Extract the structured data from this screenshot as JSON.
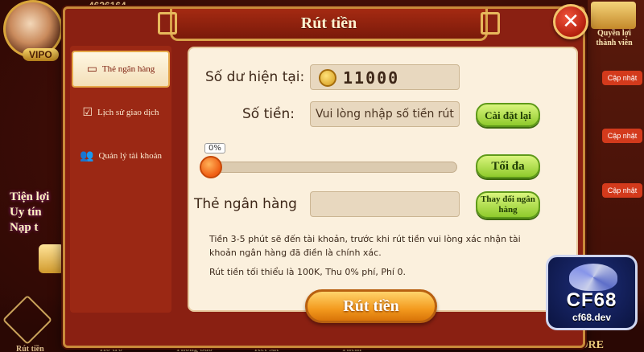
{
  "background": {
    "top_counter": "4626164",
    "vip_label": "VIPO",
    "left_promo_lines": [
      "Tiện lợi",
      "Uy tín",
      "Nạp t"
    ],
    "right_panel": {
      "gift_label": "Quyền lợi thành viên",
      "update_badges": [
        "Cập nhật",
        "Cập nhật",
        "Cập nhật"
      ]
    },
    "bottom_nav": [
      "Rút tiền",
      "Hỗ trợ",
      "Thông báo",
      "Két sắt",
      "Thêm"
    ],
    "store_label": "STORE"
  },
  "modal": {
    "title": "Rút tiền",
    "close_icon": "close-icon",
    "tabs": [
      {
        "label": "Thẻ ngân hàng",
        "icon": "card-icon",
        "active": true
      },
      {
        "label": "Lịch sử giao dịch",
        "icon": "history-icon",
        "active": false
      },
      {
        "label": "Quản lý tài khoản",
        "icon": "users-icon",
        "active": false
      }
    ],
    "balance": {
      "label": "Số dư hiện tại:",
      "value": "11000"
    },
    "amount": {
      "label": "Số tiền:",
      "placeholder": "Vui lòng nhập số tiền rút"
    },
    "reset_button": "Cài đặt lại",
    "slider": {
      "percent_label": "0%",
      "value": 0
    },
    "max_button": "Tối đa",
    "bank_card": {
      "label": "Thẻ ngân hàng",
      "value": ""
    },
    "change_bank_button": "Thay đổi ngân hàng",
    "notes": {
      "line1": "Tiền 3-5 phút sẽ đến tài khoản, trước khi rút tiền vui lòng xác nhận tài",
      "line2": "khoản ngân hàng đã điền là chính xác.",
      "line3": "Rút tiền tối thiểu là 100K, Thu 0% phí, Phí 0."
    },
    "submit_button": "Rút tiền"
  },
  "logo": {
    "main": "CF68",
    "sub": "cf68.dev"
  },
  "colors": {
    "modal_frame": "#8a2012",
    "panel_bg": "#fbf0dd",
    "green_button": "#8fca2c",
    "orange_button": "#f39a1e",
    "close_button": "#d8301a"
  }
}
